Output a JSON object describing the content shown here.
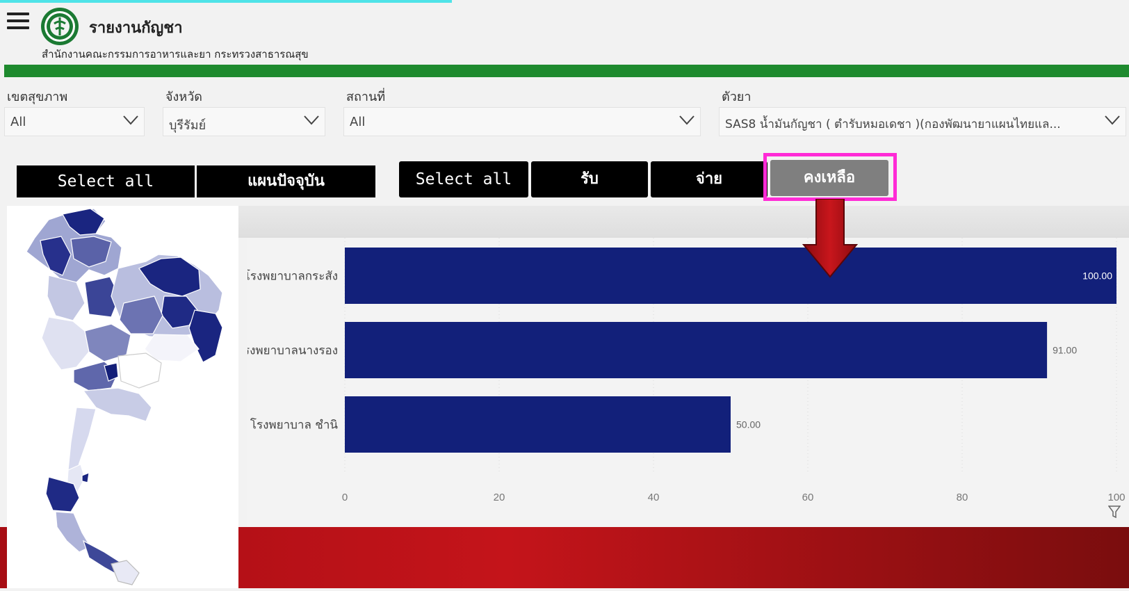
{
  "header": {
    "title": "รายงานกัญชา",
    "subtitle": "สำนักงานคณะกรรมการอาหารและยา กระทรวงสาธารณสุข"
  },
  "filters": [
    {
      "label": "เขตสุขภาพ",
      "value": "All"
    },
    {
      "label": "จังหวัด",
      "value": "บุรีรัมย์"
    },
    {
      "label": "สถานที่",
      "value": "All"
    },
    {
      "label": "ตัวยา",
      "value": "SAS8 น้ำมันกัญชา ( ตำรับหมอเดชา )(กองพัฒนายาแผนไทยแล..."
    }
  ],
  "buttons_group1": [
    {
      "label": "Select all"
    },
    {
      "label": "แผนปัจจุบัน"
    }
  ],
  "buttons_group2": [
    {
      "label": "Select all"
    },
    {
      "label": "รับ"
    },
    {
      "label": "จ่าย"
    },
    {
      "label": "คงเหลือ",
      "selected": true
    }
  ],
  "colors": {
    "accent_green": "#1e8a2e",
    "bar": "#12207a",
    "highlight": "#ff2bd6",
    "arrow": "#b80f14",
    "selected_button": "#7f7f7f"
  },
  "chart_data": {
    "type": "bar",
    "orientation": "horizontal",
    "categories": [
      "โรงพยาบาลกระสัง",
      "โรงพยาบาลนางรอง",
      "โรงพยาบาล ชำนิ"
    ],
    "values": [
      100,
      91,
      50
    ],
    "data_labels": [
      "100.00",
      "91.00",
      "50.00"
    ],
    "x_ticks": [
      "0",
      "20",
      "40",
      "60",
      "80",
      "100"
    ],
    "xlim": [
      0,
      100
    ],
    "grid": true
  }
}
